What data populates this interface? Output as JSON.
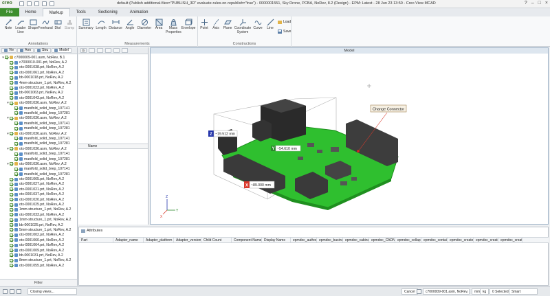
{
  "window": {
    "logo": "creo",
    "title": "default (Publish additional-files=\"PUBLISH_3D\" evaluate-rules-on-republish=\"true\") - 0000001551, Sky Drone, PCBA, NoRev, 8.2 (Design) - EPM: Latest - 28 Jun 23 13:50 - Creo View MCAD",
    "controls": [
      "?",
      "–",
      "□",
      "×"
    ]
  },
  "tabs": [
    "File",
    "Home",
    "Markup",
    "Tools",
    "Sectioning",
    "Animation"
  ],
  "active_tab": "Markup",
  "ribbon": {
    "annotations": {
      "label": "Annotations",
      "buttons": [
        "Note",
        "Leader Line",
        "Shape",
        "Freehand",
        "Dtol",
        "Stamp"
      ]
    },
    "measurements": {
      "label": "Measurements",
      "buttons": [
        "Summary",
        "Length",
        "Distance",
        "Angle",
        "Diameter",
        "Area",
        "Mass Properties",
        "Envelope"
      ]
    },
    "constructions": {
      "label": "Constructions",
      "buttons": [
        "Point",
        "Axis",
        "Plane",
        "Coordinate System",
        "Curve",
        "Line"
      ]
    },
    "extra": [
      "Load",
      "Save"
    ]
  },
  "left_panel": {
    "tabs": [
      "Vie",
      "Ann",
      "Stru",
      "Model"
    ],
    "tree": [
      {
        "level": 0,
        "expand": "▾",
        "icon": "asm",
        "label": "c7000009-001.asm, NoRev, B.1"
      },
      {
        "level": 1,
        "expand": "",
        "icon": "prt",
        "label": "c7000010-001.prt, NoRev, A.2"
      },
      {
        "level": 1,
        "expand": "",
        "icon": "prt",
        "label": "otx-0001038.prt, NoRev, A.2"
      },
      {
        "level": 1,
        "expand": "",
        "icon": "prt",
        "label": "otx-0001061.prt, NoRev, A.2"
      },
      {
        "level": 1,
        "expand": "",
        "icon": "prt",
        "label": "bb-0001018.prt, NoRev, A.2"
      },
      {
        "level": 1,
        "expand": "",
        "icon": "prt",
        "label": "4mm-structure_1.prt, NoRev, A.2"
      },
      {
        "level": 1,
        "expand": "",
        "icon": "prt",
        "label": "otx-0001023.prt, NoRev, A.2"
      },
      {
        "level": 1,
        "expand": "",
        "icon": "prt",
        "label": "bb-0001063.prt, NoRev, A.2"
      },
      {
        "level": 1,
        "expand": "",
        "icon": "prt",
        "label": "otx-0001043.prt, NoRev, A.2"
      },
      {
        "level": 1,
        "expand": "▾",
        "icon": "asm",
        "label": "otx-0001036.asm, NoRev, A.2"
      },
      {
        "level": 2,
        "expand": "",
        "icon": "prt",
        "label": "manifold_solid_brep_107141"
      },
      {
        "level": 2,
        "expand": "",
        "icon": "prt",
        "label": "manifold_solid_brep_107281"
      },
      {
        "level": 1,
        "expand": "▾",
        "icon": "asm",
        "label": "otx-0001036.asm, NoRev, A.2"
      },
      {
        "level": 2,
        "expand": "",
        "icon": "prt",
        "label": "manifold_solid_brep_107141"
      },
      {
        "level": 2,
        "expand": "",
        "icon": "prt",
        "label": "manifold_solid_brep_107281"
      },
      {
        "level": 1,
        "expand": "▾",
        "icon": "asm",
        "label": "otx-0001036.asm, NoRev, A.2"
      },
      {
        "level": 2,
        "expand": "",
        "icon": "prt",
        "label": "manifold_solid_brep_107141"
      },
      {
        "level": 2,
        "expand": "",
        "icon": "prt",
        "label": "manifold_solid_brep_107281"
      },
      {
        "level": 1,
        "expand": "▾",
        "icon": "asm",
        "label": "otx-0001036.asm, NoRev, A.2"
      },
      {
        "level": 2,
        "expand": "",
        "icon": "prt",
        "label": "manifold_solid_brep_107141"
      },
      {
        "level": 2,
        "expand": "",
        "icon": "prt",
        "label": "manifold_solid_brep_107281"
      },
      {
        "level": 1,
        "expand": "▾",
        "icon": "asm",
        "label": "otx-0001036.asm, NoRev, A.2"
      },
      {
        "level": 2,
        "expand": "",
        "icon": "prt",
        "label": "manifold_solid_brep_107141"
      },
      {
        "level": 2,
        "expand": "",
        "icon": "prt",
        "label": "manifold_solid_brep_107281"
      },
      {
        "level": 1,
        "expand": "",
        "icon": "prt",
        "label": "otx-0001065.prt, NoRev, A.2"
      },
      {
        "level": 1,
        "expand": "",
        "icon": "prt",
        "label": "otx-0001027.prt, NoRev, A.2"
      },
      {
        "level": 1,
        "expand": "",
        "icon": "prt",
        "label": "otx-0001021.prt, NoRev, A.2"
      },
      {
        "level": 1,
        "expand": "",
        "icon": "prt",
        "label": "otx-0001037.prt, NoRev, A.2"
      },
      {
        "level": 1,
        "expand": "",
        "icon": "prt",
        "label": "otx-0001020.prt, NoRev, A.2"
      },
      {
        "level": 1,
        "expand": "",
        "icon": "prt",
        "label": "otx-0001025.prt, NoRev, A.2"
      },
      {
        "level": 1,
        "expand": "",
        "icon": "prt",
        "label": "1mm-structure_1.prt, NoRev, A.2"
      },
      {
        "level": 1,
        "expand": "",
        "icon": "prt",
        "label": "otx-0001033.prt, NoRev, A.2"
      },
      {
        "level": 1,
        "expand": "",
        "icon": "prt",
        "label": "1mm-structure_1.prt, NoRev, A.2"
      },
      {
        "level": 1,
        "expand": "",
        "icon": "prt",
        "label": "bb-0001025.prt, NoRev, A.2"
      },
      {
        "level": 1,
        "expand": "",
        "icon": "prt",
        "label": "5mm-structure_1.prt, NoRev, A.2"
      },
      {
        "level": 1,
        "expand": "",
        "icon": "prt",
        "label": "otx-0001002.prt, NoRev, A.2"
      },
      {
        "level": 1,
        "expand": "",
        "icon": "prt",
        "label": "otx-0001060.prt, NoRev, A.2"
      },
      {
        "level": 1,
        "expand": "",
        "icon": "prt",
        "label": "otx-0001064.prt, NoRev, A.2"
      },
      {
        "level": 1,
        "expand": "",
        "icon": "prt",
        "label": "otx-0001009.prt, NoRev, A.2"
      },
      {
        "level": 1,
        "expand": "",
        "icon": "prt",
        "label": "bb-0001031.prt, NoRev, A.2"
      },
      {
        "level": 1,
        "expand": "",
        "icon": "prt",
        "label": "8mm-structure_1.prt, NoRev, A.2"
      },
      {
        "level": 1,
        "expand": "",
        "icon": "prt",
        "label": "otx-0001055.prt, NoRev, A.2"
      }
    ],
    "filter_label": "Filter"
  },
  "middle_panel": {
    "tab_label": "Gr",
    "name_header": "Name"
  },
  "viewport": {
    "title": "Model",
    "callout": "Change Connector",
    "dims": {
      "z": "~19.512 mm",
      "y": "~54.610 mm",
      "x": "~89.000 mm"
    },
    "axis_letters": {
      "z": "Z",
      "y": "Y",
      "x": "X"
    },
    "colors": {
      "board": "#2fbf2f",
      "board_dark": "#1f8f1f",
      "component": "#2a2a2a",
      "x_badge": "#d93a2b",
      "y_badge": "#2c8a2c",
      "z_badge": "#2233aa"
    }
  },
  "attributes": {
    "tab": "Attributes",
    "columns": [
      "Part",
      "Adapter_name",
      "Adapter_platform",
      "Adapter_version",
      "Child Count",
      "Component Name",
      "Display Name",
      "epmdoc_author",
      "epmdoc_busine",
      "epmdoc_cabinet",
      "epmdoc_CADN",
      "epmdoc_collap",
      "epmdoc_contai",
      "epmdoc_createT",
      "epmdoc_creato",
      "epmdoc_create"
    ]
  },
  "status": {
    "message": "Closing views...",
    "cancel": "Cancel",
    "selection": "c7000009-001.asm, NoRev, B.1",
    "unit_len": "mm",
    "unit_mass": "kg",
    "selected": "0 Selected",
    "filter": "Smart"
  }
}
